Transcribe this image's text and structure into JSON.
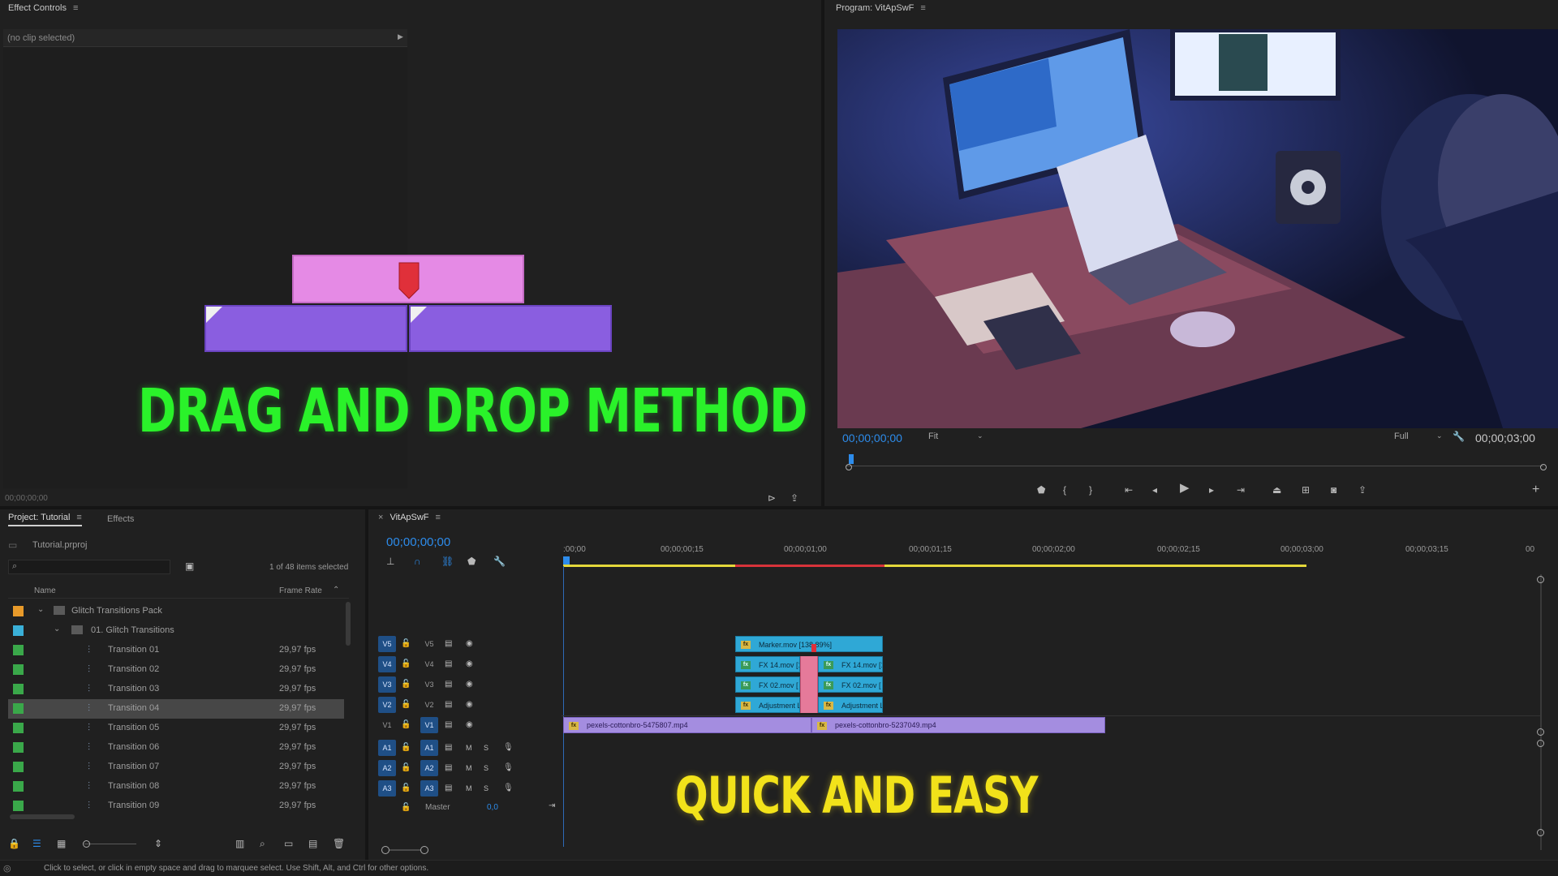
{
  "effect_controls": {
    "title": "Effect Controls",
    "no_clip": "(no clip selected)",
    "timecode": "00;00;00;00"
  },
  "program": {
    "title": "Program: VitApSwF",
    "timecode_left": "00;00;00;00",
    "fit": "Fit",
    "quality": "Full",
    "timecode_right": "00;00;03;00"
  },
  "overlay": {
    "drag_text": "DRAG AND DROP METHOD",
    "quick_text": "QUICK AND EASY"
  },
  "project": {
    "tab_project": "Project: Tutorial",
    "tab_effects": "Effects",
    "file": "Tutorial.prproj",
    "items_selected": "1 of 48 items selected",
    "col_name": "Name",
    "col_frame_rate": "Frame Rate",
    "folder1": "Glitch Transitions Pack",
    "folder2": "01. Glitch Transitions",
    "items": [
      {
        "name": "Transition 01",
        "fps": "29,97 fps"
      },
      {
        "name": "Transition 02",
        "fps": "29,97 fps"
      },
      {
        "name": "Transition 03",
        "fps": "29,97 fps"
      },
      {
        "name": "Transition 04",
        "fps": "29,97 fps"
      },
      {
        "name": "Transition 05",
        "fps": "29,97 fps"
      },
      {
        "name": "Transition 06",
        "fps": "29,97 fps"
      },
      {
        "name": "Transition 07",
        "fps": "29,97 fps"
      },
      {
        "name": "Transition 08",
        "fps": "29,97 fps"
      },
      {
        "name": "Transition 09",
        "fps": "29,97 fps"
      }
    ]
  },
  "timeline": {
    "tab": "VitApSwF",
    "timecode": "00;00;00;00",
    "ruler": [
      ":00;00",
      "00;00;00;15",
      "00;00;01;00",
      "00;00;01;15",
      "00;00;02;00",
      "00;00;02;15",
      "00;00;03;00",
      "00;00;03;15",
      "00"
    ],
    "video_tracks": [
      "V5",
      "V4",
      "V3",
      "V2",
      "V1"
    ],
    "audio_tracks": [
      "A1",
      "A2",
      "A3"
    ],
    "master": "Master",
    "master_val": "0,0",
    "clips": {
      "marker": "Marker.mov [138,89%]",
      "fx14a": "FX 14.mov [1",
      "fx14b": "FX 14.mov [1",
      "fx02a": "FX 02.mov [",
      "fx02b": "FX 02.mov [",
      "adja": "Adjustment L",
      "adjb": "Adjustment L",
      "pexels1": "pexels-cottonbro-5475807.mp4",
      "pexels2": "pexels-cottonbro-5237049.mp4"
    }
  },
  "status_bar": "Click to select, or click in empty space and drag to marquee select. Use Shift, Alt, and Ctrl for other options.",
  "colors": {
    "accent_blue": "#2d8ceb",
    "clip_blue": "#2fa8d6",
    "clip_purple": "#a48de0",
    "green_text": "#2af22a",
    "yellow_text": "#f2e21a"
  }
}
